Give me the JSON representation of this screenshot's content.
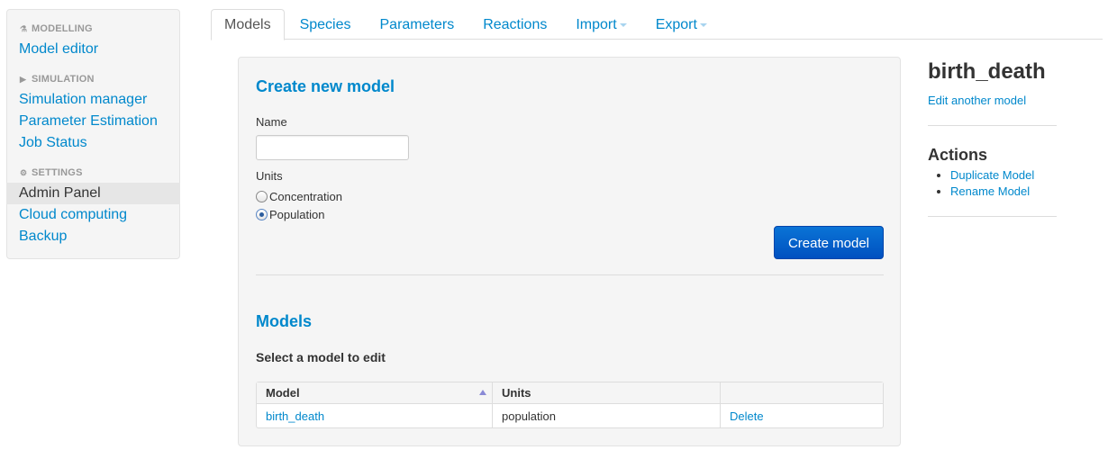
{
  "sidebar": {
    "sections": [
      {
        "header": "MODELLING",
        "icon": "flask-icon",
        "items": [
          "Model editor"
        ]
      },
      {
        "header": "SIMULATION",
        "icon": "play-icon",
        "items": [
          "Simulation manager",
          "Parameter Estimation",
          "Job Status"
        ]
      },
      {
        "header": "SETTINGS",
        "icon": "gear-icon",
        "items": [
          "Admin Panel",
          "Cloud computing",
          "Backup"
        ]
      }
    ],
    "active_item": "Admin Panel"
  },
  "tabs": [
    {
      "label": "Models",
      "active": true
    },
    {
      "label": "Species"
    },
    {
      "label": "Parameters"
    },
    {
      "label": "Reactions"
    },
    {
      "label": "Import",
      "dropdown": true
    },
    {
      "label": "Export",
      "dropdown": true
    }
  ],
  "create": {
    "title": "Create new model",
    "name_label": "Name",
    "name_value": "",
    "units_label": "Units",
    "units_options": [
      "Concentration",
      "Population"
    ],
    "units_selected": "Population",
    "button": "Create model"
  },
  "models": {
    "title": "Models",
    "subtitle": "Select a model to edit",
    "columns": [
      "Model",
      "Units",
      ""
    ],
    "rows": [
      {
        "model": "birth_death",
        "units": "population",
        "action": "Delete"
      }
    ]
  },
  "right_panel": {
    "model_name": "birth_death",
    "edit_link": "Edit another model",
    "actions_title": "Actions",
    "actions": [
      "Duplicate Model",
      "Rename Model"
    ]
  },
  "colors": {
    "link": "#0088cc",
    "primary_button": "#0a6ad0",
    "well_background": "#f5f5f5"
  }
}
